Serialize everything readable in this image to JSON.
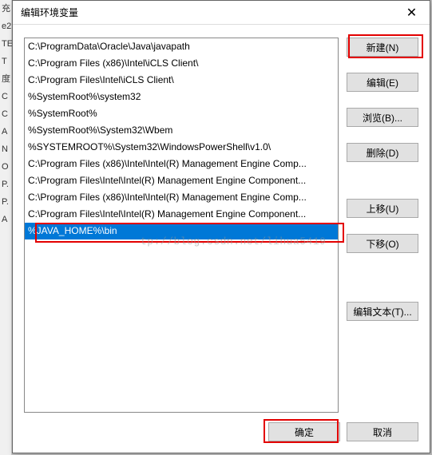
{
  "dialog": {
    "title": "编辑环境变量",
    "close": "✕"
  },
  "path_entries": [
    "C:\\ProgramData\\Oracle\\Java\\javapath",
    "C:\\Program Files (x86)\\Intel\\iCLS Client\\",
    "C:\\Program Files\\Intel\\iCLS Client\\",
    "%SystemRoot%\\system32",
    "%SystemRoot%",
    "%SystemRoot%\\System32\\Wbem",
    "%SYSTEMROOT%\\System32\\WindowsPowerShell\\v1.0\\",
    "C:\\Program Files (x86)\\Intel\\Intel(R) Management Engine Comp...",
    "C:\\Program Files\\Intel\\Intel(R) Management Engine Component...",
    "C:\\Program Files (x86)\\Intel\\Intel(R) Management Engine Comp...",
    "C:\\Program Files\\Intel\\Intel(R) Management Engine Component...",
    "%JAVA_HOME%\\bin"
  ],
  "selected_index": 11,
  "buttons": {
    "new": "新建(N)",
    "edit": "编辑(E)",
    "browse": "浏览(B)...",
    "delete": "删除(D)",
    "moveup": "上移(U)",
    "movedown": "下移(O)",
    "edittext": "编辑文本(T)...",
    "ok": "确定",
    "cancel": "取消"
  },
  "watermark": "tp://blog.csdn.net/lihua5419",
  "bg_fragments": [
    "充",
    "e2",
    "TE",
    "T",
    "",
    "",
    "度",
    "C",
    "C",
    "A",
    "N",
    "O",
    "P.",
    "P.",
    "A"
  ]
}
